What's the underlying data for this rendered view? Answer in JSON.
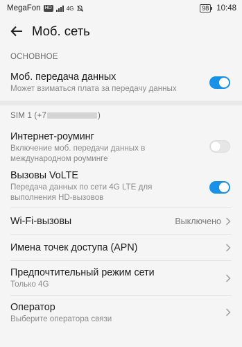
{
  "status": {
    "carrier": "MegaFon",
    "hd_badge": "HD",
    "network_type": "4G",
    "battery": "98",
    "time": "10:48"
  },
  "header": {
    "title": "Моб. сеть"
  },
  "section_basic": {
    "label": "ОСНОВНОЕ"
  },
  "mobile_data": {
    "title": "Моб. передача данных",
    "subtitle": "Может взиматься плата за передачу данных",
    "enabled": true
  },
  "sim": {
    "label_prefix": "SIM 1 (+7",
    "label_suffix": ")"
  },
  "roaming": {
    "title": "Интернет-роуминг",
    "subtitle_line1": "Включение моб. передачи данных в",
    "subtitle_line2": "международном роуминге",
    "enabled": false
  },
  "volte": {
    "title": "Вызовы VoLTE",
    "subtitle_line1": "Передача данных по сети 4G LTE для",
    "subtitle_line2": "выполнения HD-вызовов",
    "enabled": true
  },
  "wifi_calls": {
    "title": "Wi-Fi-вызовы",
    "value": "Выключено"
  },
  "apn": {
    "title": "Имена точек доступа (APN)"
  },
  "preferred_mode": {
    "title": "Предпочтительный режим сети",
    "subtitle": "Только 4G"
  },
  "operator": {
    "title": "Оператор",
    "subtitle": "Выберите оператора связи"
  },
  "colors": {
    "accent": "#1a91e8",
    "background": "#f5f5f5"
  },
  "icons": [
    "back-arrow-icon",
    "chevron-right-icon",
    "signal-icon",
    "silent-icon",
    "battery-icon"
  ]
}
